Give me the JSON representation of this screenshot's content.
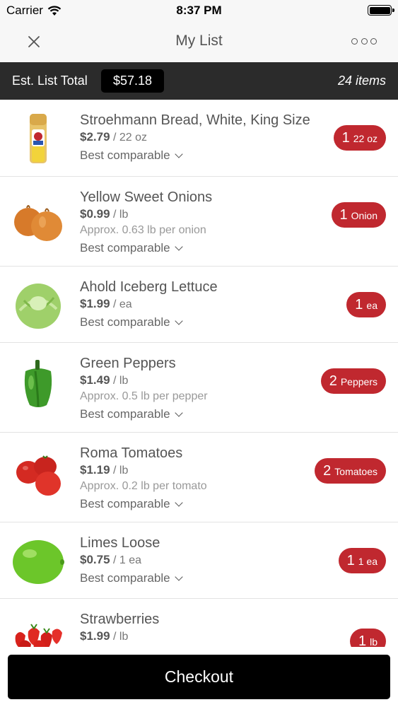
{
  "status": {
    "carrier": "Carrier",
    "time": "8:37 PM"
  },
  "nav": {
    "title": "My List",
    "close_icon": "close-icon",
    "more_icon": "more-dots-icon"
  },
  "summary": {
    "label": "Est. List Total",
    "total": "$57.18",
    "count": "24 items"
  },
  "items": [
    {
      "name": "Stroehmann Bread, White, King Size",
      "price": "$2.79",
      "unit": " / 22 oz",
      "approx": "",
      "comparable": "Best comparable",
      "qty": "1",
      "qty_unit": "22 oz"
    },
    {
      "name": "Yellow Sweet Onions",
      "price": "$0.99",
      "unit": " / lb",
      "approx": "Approx. 0.63 lb per onion",
      "comparable": "Best comparable",
      "qty": "1",
      "qty_unit": "Onion"
    },
    {
      "name": "Ahold Iceberg Lettuce",
      "price": "$1.99",
      "unit": " / ea",
      "approx": "",
      "comparable": "Best comparable",
      "qty": "1",
      "qty_unit": "ea"
    },
    {
      "name": "Green Peppers",
      "price": "$1.49",
      "unit": " / lb",
      "approx": "Approx. 0.5 lb per pepper",
      "comparable": "Best comparable",
      "qty": "2",
      "qty_unit": "Peppers"
    },
    {
      "name": "Roma Tomatoes",
      "price": "$1.19",
      "unit": " / lb",
      "approx": "Approx. 0.2 lb per tomato",
      "comparable": "Best comparable",
      "qty": "2",
      "qty_unit": "Tomatoes"
    },
    {
      "name": "Limes Loose",
      "price": "$0.75",
      "unit": " / 1 ea",
      "approx": "",
      "comparable": "Best comparable",
      "qty": "1",
      "qty_unit": "1 ea"
    },
    {
      "name": "Strawberries",
      "price": "$1.99",
      "unit": " / lb",
      "approx": "",
      "comparable": "",
      "qty": "1",
      "qty_unit": "lb"
    }
  ],
  "checkout": {
    "label": "Checkout"
  },
  "colors": {
    "accent": "#c0282f",
    "summary_bar": "#2b2b2b",
    "checkout_bg": "#000000"
  }
}
